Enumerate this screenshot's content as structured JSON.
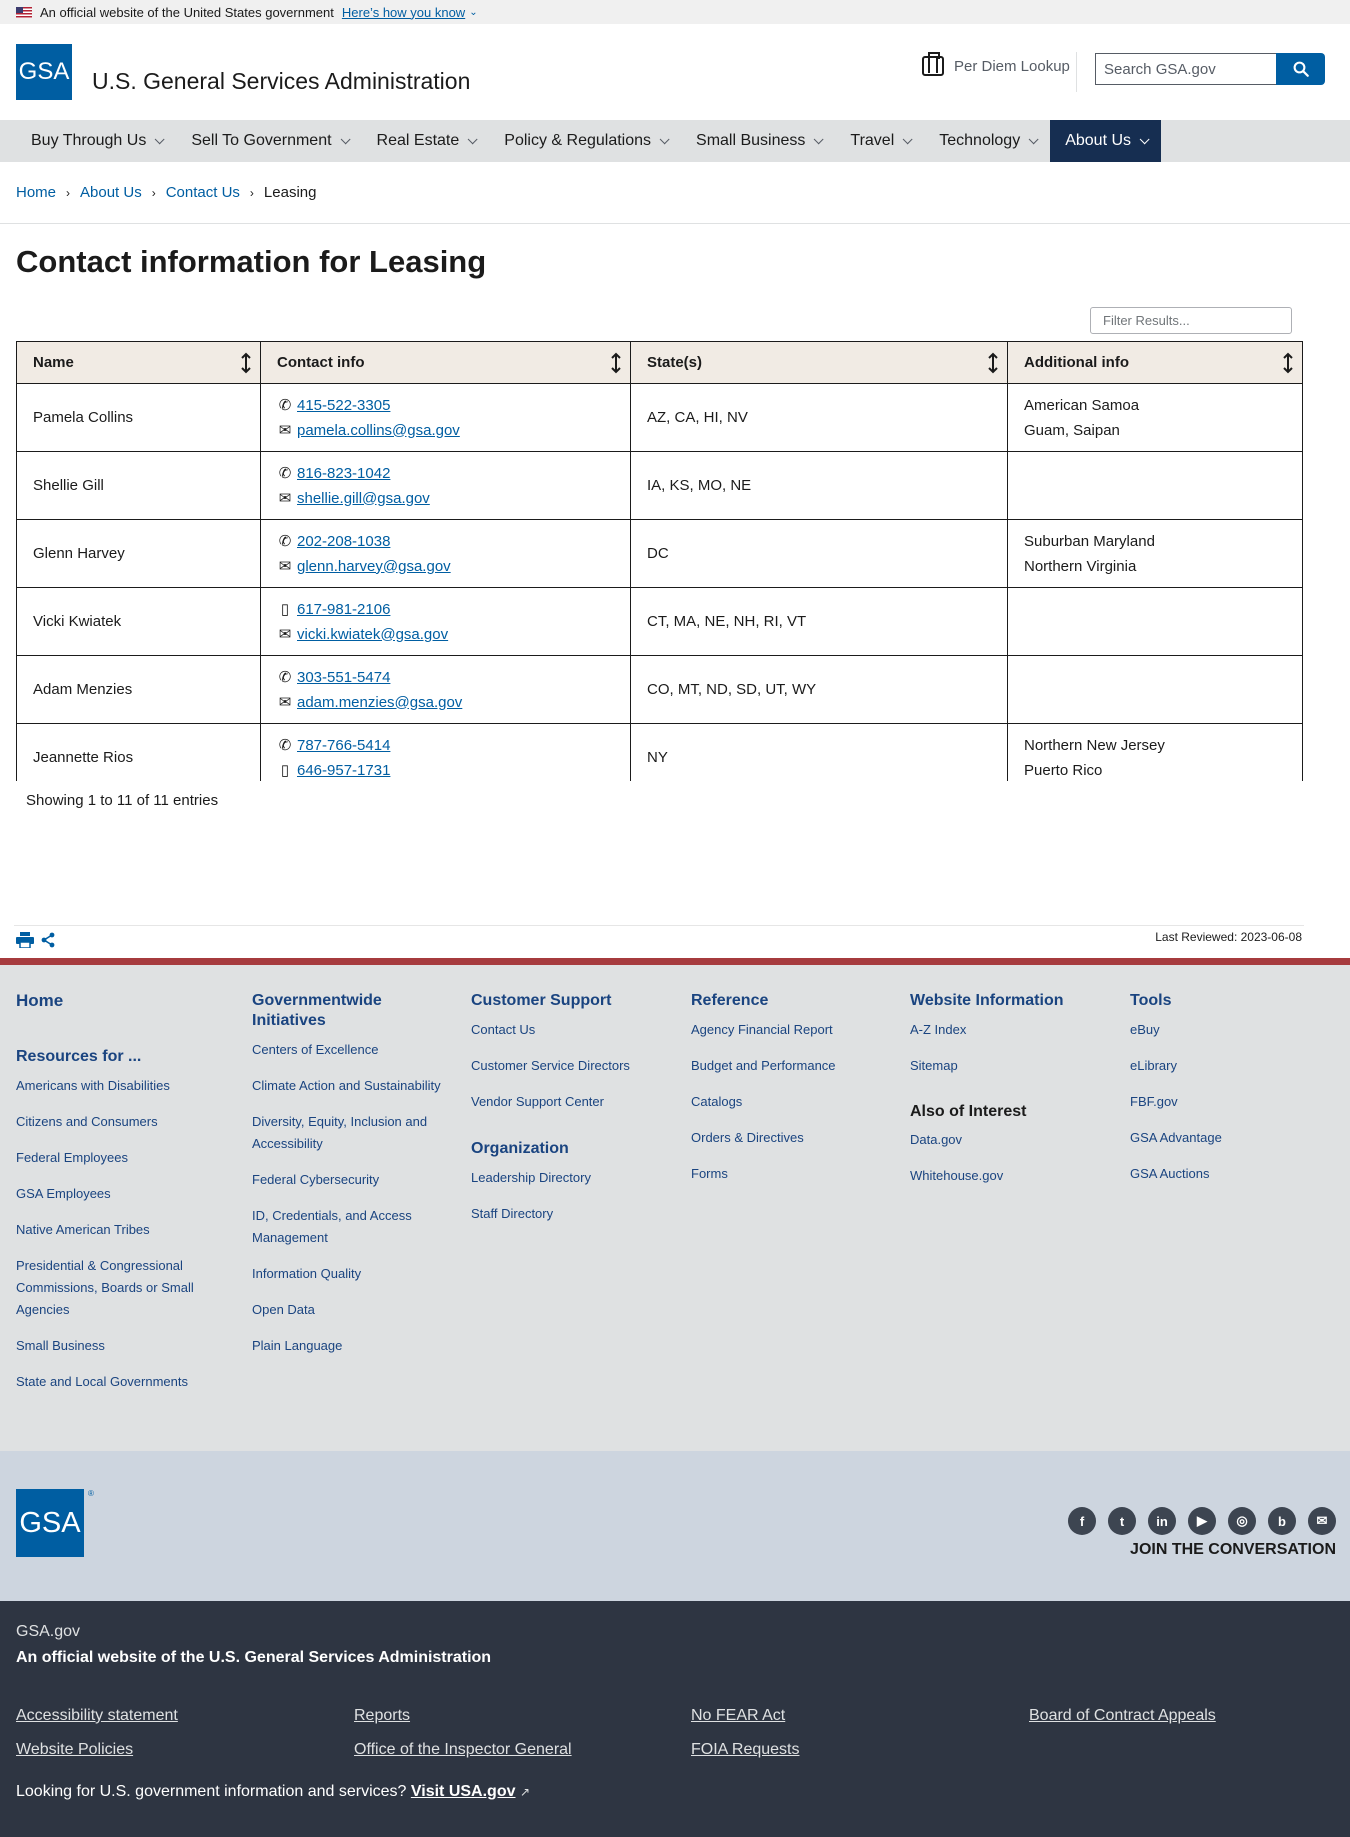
{
  "gov_banner": {
    "text": "An official website of the United States government",
    "link": "Here’s how you know"
  },
  "header": {
    "logo_text": "GSA",
    "site_title": "U.S. General Services Administration",
    "per_diem": "Per Diem Lookup",
    "search_placeholder": "Search GSA.gov"
  },
  "nav": {
    "items": [
      {
        "label": "Buy Through Us"
      },
      {
        "label": "Sell To Government"
      },
      {
        "label": "Real Estate"
      },
      {
        "label": "Policy & Regulations"
      },
      {
        "label": "Small Business"
      },
      {
        "label": "Travel"
      },
      {
        "label": "Technology"
      },
      {
        "label": "About Us",
        "active": true
      }
    ]
  },
  "breadcrumb": [
    "Home",
    "About Us",
    "Contact Us",
    "Leasing"
  ],
  "page": {
    "title": "Contact information for Leasing",
    "filter_placeholder": "Filter Results...",
    "showing": "Showing 1 to 11 of 11 entries",
    "last_reviewed": "Last Reviewed: 2023-06-08"
  },
  "table": {
    "headers": [
      "Name",
      "Contact info",
      "State(s)",
      "Additional info"
    ],
    "rows": [
      {
        "name": "Pamela Collins",
        "contacts": [
          {
            "icon": "phone-icon",
            "value": "415-522-3305"
          },
          {
            "icon": "email-icon",
            "value": "pamela.collins@gsa.gov"
          }
        ],
        "states": "AZ, CA, HI, NV",
        "additional": [
          "American Samoa",
          "Guam, Saipan"
        ]
      },
      {
        "name": "Shellie Gill",
        "contacts": [
          {
            "icon": "phone-icon",
            "value": "816-823-1042"
          },
          {
            "icon": "email-icon",
            "value": "shellie.gill@gsa.gov"
          }
        ],
        "states": "IA, KS, MO, NE",
        "additional": []
      },
      {
        "name": "Glenn Harvey",
        "contacts": [
          {
            "icon": "phone-icon",
            "value": "202-208-1038"
          },
          {
            "icon": "email-icon",
            "value": "glenn.harvey@gsa.gov"
          }
        ],
        "states": "DC",
        "additional": [
          "Suburban Maryland",
          "Northern Virginia"
        ]
      },
      {
        "name": "Vicki Kwiatek",
        "contacts": [
          {
            "icon": "mobile-icon",
            "value": "617-981-2106"
          },
          {
            "icon": "email-icon",
            "value": "vicki.kwiatek@gsa.gov"
          }
        ],
        "states": "CT, MA, NE, NH, RI, VT",
        "additional": []
      },
      {
        "name": "Adam Menzies",
        "contacts": [
          {
            "icon": "phone-icon",
            "value": "303-551-5474"
          },
          {
            "icon": "email-icon",
            "value": "adam.menzies@gsa.gov"
          }
        ],
        "states": "CO, MT, ND, SD, UT, WY",
        "additional": []
      },
      {
        "name": "Jeannette Rios",
        "contacts": [
          {
            "icon": "phone-icon",
            "value": "787-766-5414"
          },
          {
            "icon": "mobile-icon",
            "value": "646-957-1731"
          }
        ],
        "states": "NY",
        "additional": [
          "Northern New Jersey",
          "Puerto Rico"
        ]
      }
    ]
  },
  "footer": {
    "home": "Home",
    "resources_head": "Resources for ...",
    "resources": [
      "Americans with Disabilities",
      "Citizens and Consumers",
      "Federal Employees",
      "GSA Employees",
      "Native American Tribes",
      "Presidential & Congressional Commissions, Boards or Small Agencies",
      "Small Business",
      "State and Local Governments"
    ],
    "initiatives_head": "Governmentwide Initiatives",
    "initiatives": [
      "Centers of Excellence",
      "Climate Action and Sustainability",
      "Diversity, Equity, Inclusion and Accessibility",
      "Federal Cybersecurity",
      "ID, Credentials, and Access Management",
      "Information Quality",
      "Open Data",
      "Plain Language"
    ],
    "support_head": "Customer Support",
    "support": [
      "Contact Us",
      "Customer Service Directors",
      "Vendor Support Center"
    ],
    "org_head": "Organization",
    "org": [
      "Leadership Directory",
      "Staff Directory"
    ],
    "reference_head": "Reference",
    "reference": [
      "Agency Financial Report",
      "Budget and Performance",
      "Catalogs",
      "Orders & Directives",
      "Forms"
    ],
    "website_head": "Website Information",
    "website": [
      "A-Z Index",
      "Sitemap"
    ],
    "also_head": "Also of Interest",
    "also": [
      "Data.gov",
      "Whitehouse.gov"
    ],
    "tools_head": "Tools",
    "tools": [
      "eBuy",
      "eLibrary",
      "FBF.gov",
      "GSA Advantage",
      "GSA Auctions"
    ],
    "logo_text": "GSA",
    "logo_reg": "®",
    "join": "JOIN THE CONVERSATION",
    "social": [
      {
        "name": "facebook-icon",
        "glyph": "f"
      },
      {
        "name": "twitter-icon",
        "glyph": "t"
      },
      {
        "name": "linkedin-icon",
        "glyph": "in"
      },
      {
        "name": "youtube-icon",
        "glyph": "▶"
      },
      {
        "name": "instagram-icon",
        "glyph": "◎"
      },
      {
        "name": "blog-icon",
        "glyph": "b"
      },
      {
        "name": "email-icon",
        "glyph": "✉"
      }
    ]
  },
  "identifier": {
    "domain": "GSA.gov",
    "official": "An official website of the U.S. General Services Administration",
    "links": [
      "Accessibility statement",
      "Reports",
      "No FEAR Act",
      "Board of Contract Appeals",
      "Website Policies",
      "Office of the Inspector General",
      "FOIA Requests"
    ],
    "usa_text": "Looking for U.S. government information and services?",
    "usa_link": "Visit USA.gov"
  }
}
